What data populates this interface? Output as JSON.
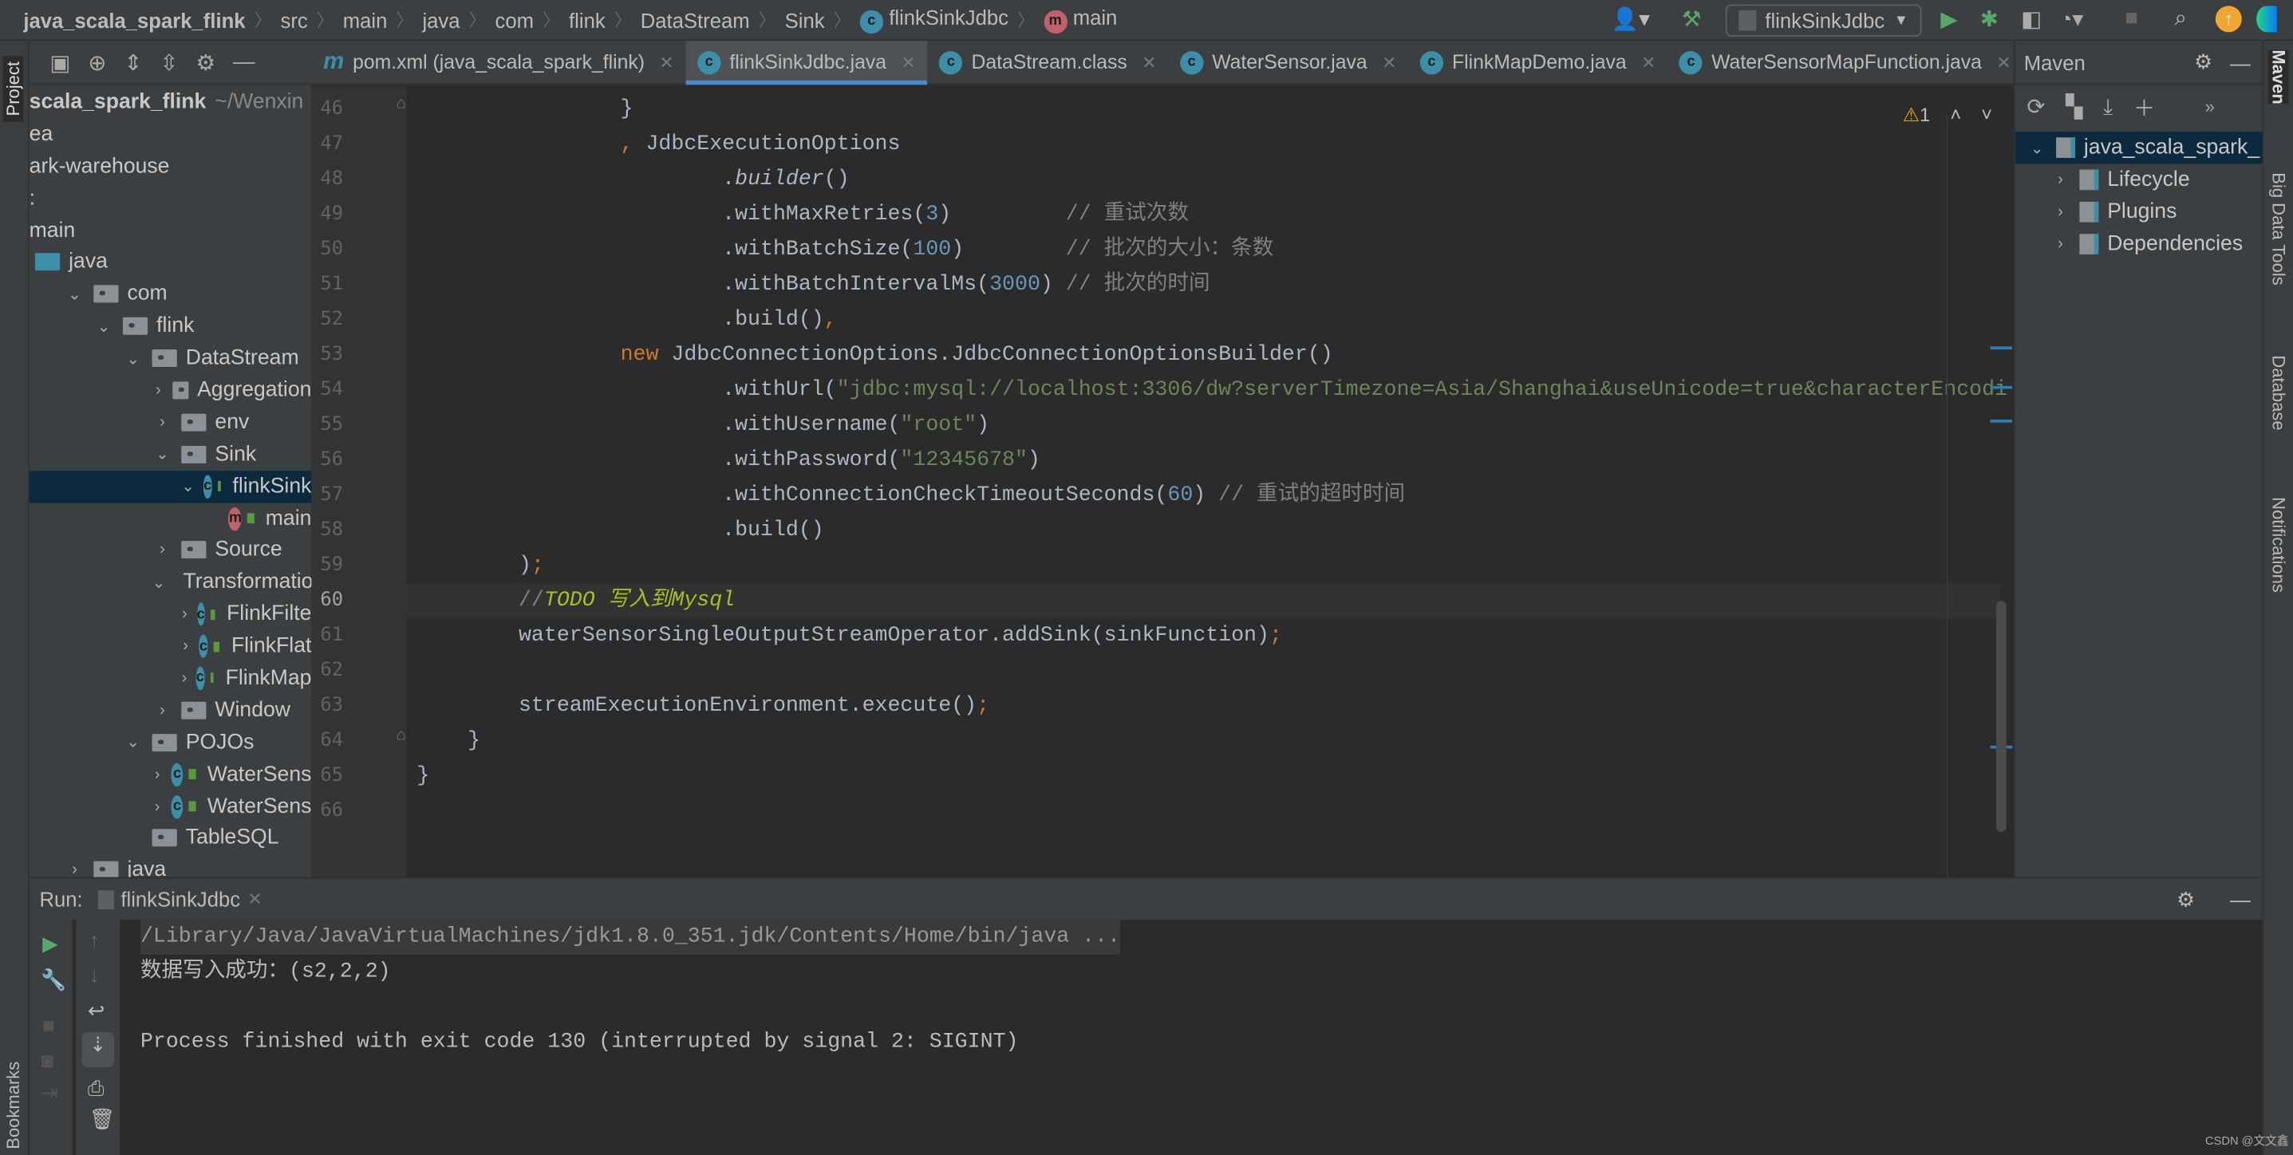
{
  "breadcrumb": [
    "java_scala_spark_flink",
    "src",
    "main",
    "java",
    "com",
    "flink",
    "DataStream",
    "Sink",
    "flinkSinkJdbc",
    "main"
  ],
  "run_config": "flinkSinkJdbc",
  "project": {
    "label": "Project",
    "root": "scala_spark_flink",
    "root_path": "~/Wenxin",
    "tree": [
      {
        "label": "ea",
        "depth": 0,
        "type": "none"
      },
      {
        "label": "ark-warehouse",
        "depth": 0,
        "type": "none"
      },
      {
        "label": ":",
        "depth": 0,
        "type": "none"
      },
      {
        "label": "main",
        "depth": 0,
        "type": "none"
      },
      {
        "label": "java",
        "depth": 0,
        "type": "src"
      },
      {
        "label": "com",
        "depth": 1,
        "type": "folder",
        "expanded": true
      },
      {
        "label": "flink",
        "depth": 2,
        "type": "folder",
        "expanded": true
      },
      {
        "label": "DataStream",
        "depth": 3,
        "type": "folder",
        "expanded": true
      },
      {
        "label": "Aggregation",
        "depth": 4,
        "type": "folder",
        "expanded": false
      },
      {
        "label": "env",
        "depth": 4,
        "type": "folder",
        "expanded": false
      },
      {
        "label": "Sink",
        "depth": 4,
        "type": "folder",
        "expanded": true
      },
      {
        "label": "flinkSink",
        "depth": 5,
        "type": "runclass",
        "expanded": true,
        "selected": true
      },
      {
        "label": "main",
        "depth": 6,
        "type": "method"
      },
      {
        "label": "Source",
        "depth": 4,
        "type": "folder",
        "expanded": false
      },
      {
        "label": "Transformatio",
        "depth": 4,
        "type": "folder",
        "expanded": true
      },
      {
        "label": "FlinkFilte",
        "depth": 5,
        "type": "runclass",
        "expanded": false
      },
      {
        "label": "FlinkFlat",
        "depth": 5,
        "type": "runclass",
        "expanded": false
      },
      {
        "label": "FlinkMap",
        "depth": 5,
        "type": "runclass",
        "expanded": false
      },
      {
        "label": "Window",
        "depth": 4,
        "type": "folder",
        "expanded": false
      },
      {
        "label": "POJOs",
        "depth": 3,
        "type": "folder",
        "expanded": true
      },
      {
        "label": "WaterSens",
        "depth": 4,
        "type": "class",
        "expanded": false
      },
      {
        "label": "WaterSens",
        "depth": 4,
        "type": "class",
        "expanded": false
      },
      {
        "label": "TableSQL",
        "depth": 3,
        "type": "folder",
        "leaf": true
      },
      {
        "label": "java",
        "depth": 1,
        "type": "folder",
        "expanded": false
      }
    ]
  },
  "tabs": [
    {
      "label": "pom.xml (java_scala_spark_flink)",
      "icon": "maven-icon"
    },
    {
      "label": "flinkSinkJdbc.java",
      "icon": "class-icon",
      "active": true
    },
    {
      "label": "DataStream.class",
      "icon": "class-icon"
    },
    {
      "label": "WaterSensor.java",
      "icon": "class-icon"
    },
    {
      "label": "FlinkMapDemo.java",
      "icon": "class-icon"
    },
    {
      "label": "WaterSensorMapFunction.java",
      "icon": "class-icon"
    }
  ],
  "editor": {
    "warnings": "1",
    "current_line": 60,
    "lines": [
      {
        "n": "46",
        "tokens": [
          [
            "                }",
            ""
          ]
        ]
      },
      {
        "n": "47",
        "tokens": [
          [
            "                ",
            ""
          ],
          [
            ",",
            "kw"
          ],
          [
            " JdbcExecutionOptions",
            ""
          ]
        ]
      },
      {
        "n": "48",
        "tokens": [
          [
            "                        .",
            ""
          ],
          [
            "builder",
            "it"
          ],
          [
            "()",
            ""
          ]
        ]
      },
      {
        "n": "49",
        "tokens": [
          [
            "                        .withMaxRetries(",
            ""
          ],
          [
            "3",
            "num"
          ],
          [
            ")         ",
            ""
          ],
          [
            "// 重试次数",
            "com"
          ]
        ]
      },
      {
        "n": "50",
        "tokens": [
          [
            "                        .withBatchSize(",
            ""
          ],
          [
            "100",
            "num"
          ],
          [
            ")        ",
            ""
          ],
          [
            "// 批次的大小：条数",
            "com"
          ]
        ]
      },
      {
        "n": "51",
        "tokens": [
          [
            "                        .withBatchIntervalMs(",
            ""
          ],
          [
            "3000",
            "num"
          ],
          [
            ") ",
            ""
          ],
          [
            "// 批次的时间",
            "com"
          ]
        ]
      },
      {
        "n": "52",
        "tokens": [
          [
            "                        .build()",
            ""
          ],
          [
            ",",
            "kw"
          ]
        ]
      },
      {
        "n": "53",
        "tokens": [
          [
            "                ",
            ""
          ],
          [
            "new",
            "kw"
          ],
          [
            " JdbcConnectionOptions.JdbcConnectionOptionsBuilder()",
            ""
          ]
        ]
      },
      {
        "n": "54",
        "tokens": [
          [
            "                        .withUrl(",
            ""
          ],
          [
            "\"jdbc:mysql://localhost:3306/dw?serverTimezone=Asia/Shanghai&useUnicode=true&characterEncodi",
            "str"
          ]
        ]
      },
      {
        "n": "55",
        "tokens": [
          [
            "                        .withUsername(",
            ""
          ],
          [
            "\"root\"",
            "str"
          ],
          [
            ")",
            ""
          ]
        ]
      },
      {
        "n": "56",
        "tokens": [
          [
            "                        .withPassword(",
            ""
          ],
          [
            "\"12345678\"",
            "str"
          ],
          [
            ")",
            ""
          ]
        ]
      },
      {
        "n": "57",
        "tokens": [
          [
            "                        .withConnectionCheckTimeoutSeconds(",
            ""
          ],
          [
            "60",
            "num"
          ],
          [
            ") ",
            ""
          ],
          [
            "// 重试的超时时间",
            "com"
          ]
        ]
      },
      {
        "n": "58",
        "tokens": [
          [
            "                        .build()",
            ""
          ]
        ]
      },
      {
        "n": "59",
        "tokens": [
          [
            "        )",
            ""
          ],
          [
            ";",
            "kw"
          ]
        ]
      },
      {
        "n": "60",
        "tokens": [
          [
            "        ",
            ""
          ],
          [
            "//",
            "com"
          ],
          [
            "TODO 写入到Mysql",
            "todo"
          ]
        ]
      },
      {
        "n": "61",
        "tokens": [
          [
            "        waterSensorSingleOutputStreamOperator.addSink(sinkFunction)",
            ""
          ],
          [
            ";",
            "kw"
          ]
        ]
      },
      {
        "n": "62",
        "tokens": []
      },
      {
        "n": "63",
        "tokens": [
          [
            "        streamExecutionEnvironment.execute()",
            ""
          ],
          [
            ";",
            "kw"
          ]
        ]
      },
      {
        "n": "64",
        "tokens": [
          [
            "    }",
            ""
          ]
        ]
      },
      {
        "n": "65",
        "tokens": [
          [
            "}",
            ""
          ]
        ]
      },
      {
        "n": "66",
        "tokens": []
      }
    ]
  },
  "maven": {
    "title": "Maven",
    "items": [
      {
        "label": "java_scala_spark_",
        "expanded": true,
        "selected": true
      },
      {
        "label": "Lifecycle"
      },
      {
        "label": "Plugins"
      },
      {
        "label": "Dependencies"
      }
    ]
  },
  "right_strip": [
    "Maven",
    "Big Data Tools",
    "Database",
    "Notifications"
  ],
  "left_strip_bottom": "Bookmarks",
  "run": {
    "label": "Run:",
    "tab": "flinkSinkJdbc",
    "output": [
      "/Library/Java/JavaVirtualMachines/jdk1.8.0_351.jdk/Contents/Home/bin/java ...",
      "数据写入成功：(s2,2,2)",
      "",
      "Process finished with exit code 130 (interrupted by signal 2: SIGINT)"
    ]
  },
  "watermark": "CSDN @文文鑫"
}
